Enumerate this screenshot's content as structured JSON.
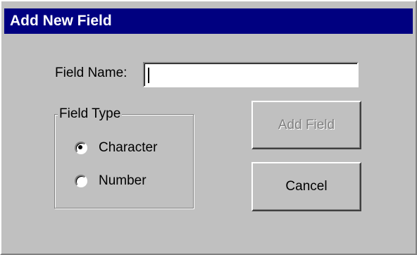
{
  "dialog": {
    "title": "Add New Field",
    "field_name": {
      "label": "Field Name:",
      "value": ""
    },
    "field_type": {
      "legend": "Field Type",
      "options": [
        {
          "label": "Character",
          "checked": true
        },
        {
          "label": "Number",
          "checked": false
        }
      ]
    },
    "buttons": {
      "add_field": {
        "label": "Add Field",
        "enabled": false
      },
      "cancel": {
        "label": "Cancel",
        "enabled": true
      }
    }
  },
  "colors": {
    "titlebar": "#000080",
    "dialog_bg": "#c0c0c0",
    "disabled_text": "#808080"
  }
}
